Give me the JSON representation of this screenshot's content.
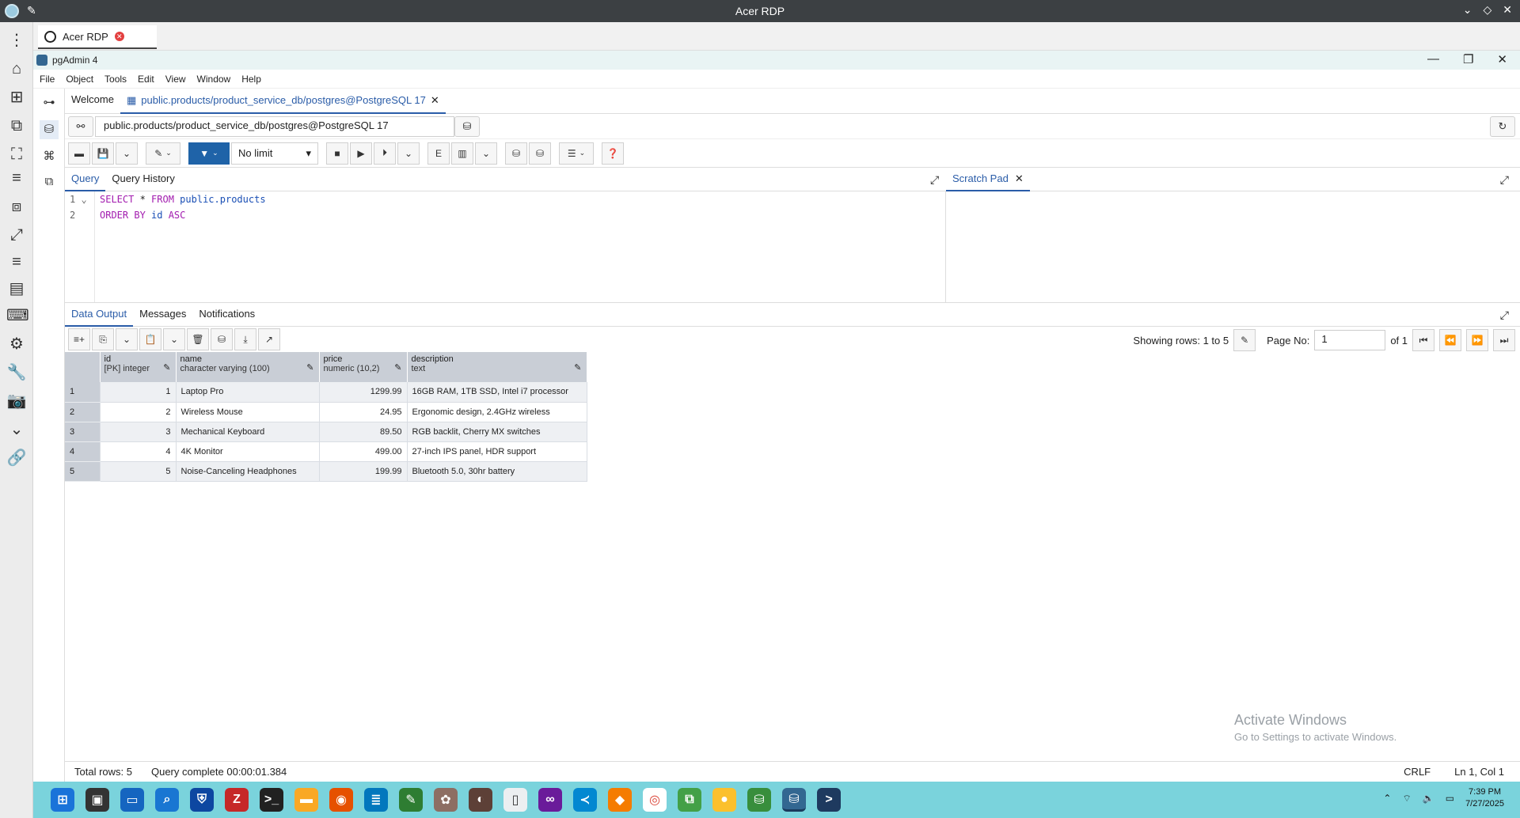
{
  "rdp": {
    "window_title": "Acer RDP",
    "tab_label": "Acer RDP"
  },
  "pgadmin": {
    "title": "pgAdmin 4",
    "menu": [
      "File",
      "Object",
      "Tools",
      "Edit",
      "View",
      "Window",
      "Help"
    ],
    "tabs": {
      "welcome": "Welcome",
      "query_tab": "public.products/product_service_db/postgres@PostgreSQL 17"
    },
    "connection": "public.products/product_service_db/postgres@PostgreSQL 17",
    "toolbar": {
      "limit": "No limit"
    },
    "query_tabs": [
      "Query",
      "Query History"
    ],
    "scratch_pad": "Scratch Pad",
    "code_lines": [
      {
        "num": "1",
        "kw1": "SELECT",
        "mid": " * ",
        "kw2": "FROM",
        "obj": " public.products"
      },
      {
        "num": "2",
        "kw1": "ORDER BY",
        "mid": " id ",
        "kw2": "ASC",
        "obj": ""
      }
    ],
    "output_tabs": [
      "Data Output",
      "Messages",
      "Notifications"
    ],
    "paging": {
      "showing": "Showing rows: 1 to 5",
      "page_label": "Page No:",
      "page_value": "1",
      "of": "of 1"
    },
    "columns": [
      {
        "name": "id",
        "type": "[PK] integer"
      },
      {
        "name": "name",
        "type": "character varying (100)"
      },
      {
        "name": "price",
        "type": "numeric (10,2)"
      },
      {
        "name": "description",
        "type": "text"
      }
    ],
    "rows": [
      {
        "rn": "1",
        "id": "1",
        "name": "Laptop Pro",
        "price": "1299.99",
        "description": "16GB RAM, 1TB SSD, Intel i7 processor"
      },
      {
        "rn": "2",
        "id": "2",
        "name": "Wireless Mouse",
        "price": "24.95",
        "description": "Ergonomic design, 2.4GHz wireless"
      },
      {
        "rn": "3",
        "id": "3",
        "name": "Mechanical Keyboard",
        "price": "89.50",
        "description": "RGB backlit, Cherry MX switches"
      },
      {
        "rn": "4",
        "id": "4",
        "name": "4K Monitor",
        "price": "499.00",
        "description": "27-inch IPS panel, HDR support"
      },
      {
        "rn": "5",
        "id": "5",
        "name": "Noise-Canceling Headphones",
        "price": "199.99",
        "description": "Bluetooth 5.0, 30hr battery"
      }
    ],
    "status": {
      "total_rows": "Total rows: 5",
      "query_complete": "Query complete 00:00:01.384",
      "line_ending": "CRLF",
      "cursor": "Ln 1, Col 1"
    }
  },
  "watermark": {
    "title": "Activate Windows",
    "subtitle": "Go to Settings to activate Windows."
  },
  "taskbar": {
    "time": "7:39 PM",
    "date": "7/27/2025"
  },
  "colors": {
    "accent": "#2a5ca8",
    "taskbar": "#7ad3dc",
    "grid_header": "#c9ced6"
  }
}
